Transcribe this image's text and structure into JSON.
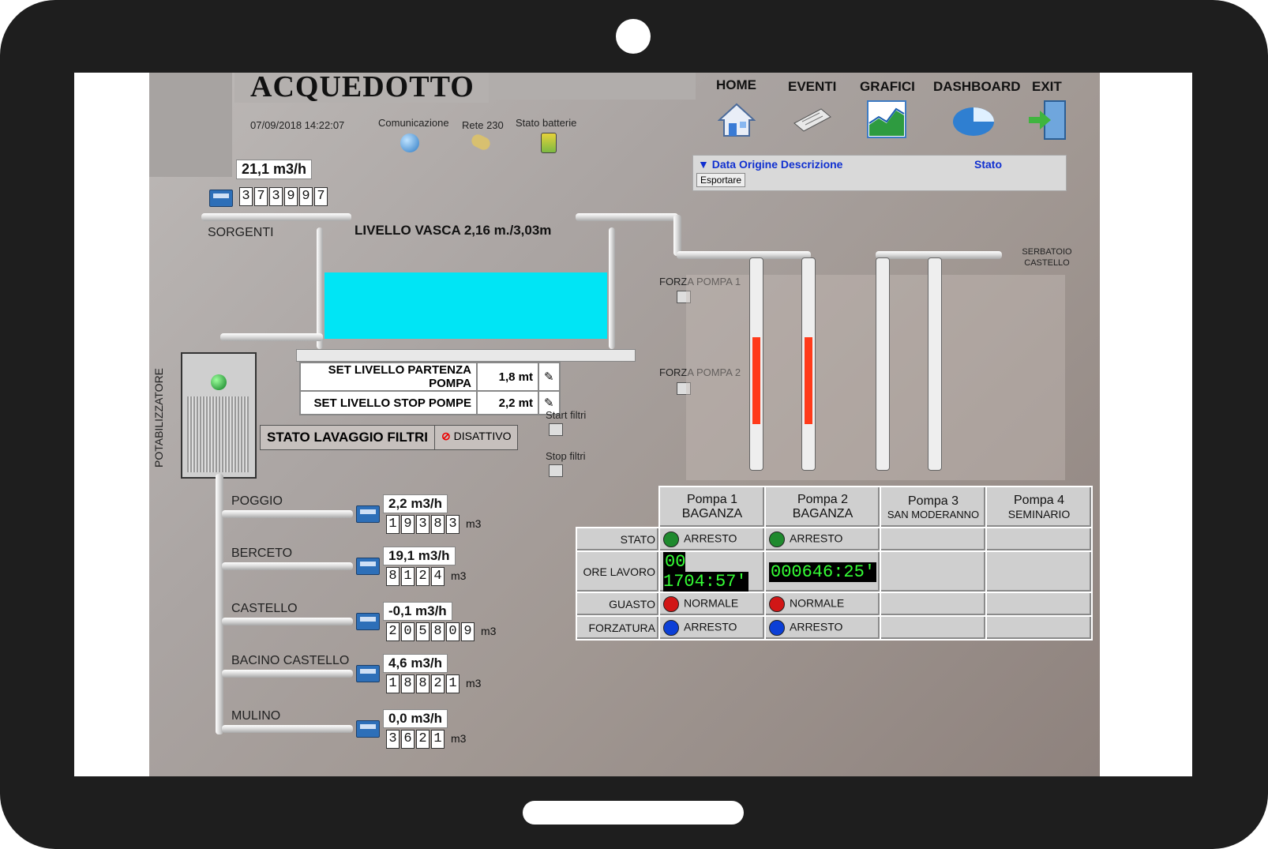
{
  "header": {
    "title": "ACQUEDOTTO",
    "datetime": "07/09/2018 14:22:07",
    "status_icons": [
      {
        "label": "Comunicazione",
        "icon": "globe-check-icon"
      },
      {
        "label": "Rete 230",
        "icon": "plug-icon"
      },
      {
        "label": "Stato batterie",
        "icon": "battery-icon"
      }
    ]
  },
  "nav": [
    {
      "label": "HOME",
      "icon": "home-icon"
    },
    {
      "label": "EVENTI",
      "icon": "newspaper-icon"
    },
    {
      "label": "GRAFICI",
      "icon": "chart-icon"
    },
    {
      "label": "DASHBOARD",
      "icon": "pie-icon"
    },
    {
      "label": "EXIT",
      "icon": "exit-door-icon"
    }
  ],
  "events": {
    "columns": "Data Origine Descrizione",
    "stato": "Stato",
    "export": "Esportare"
  },
  "sorgenti": {
    "label": "SORGENTI",
    "flow": "21,1 m3/h",
    "counter": [
      "3",
      "7",
      "3",
      "9",
      "9",
      "7"
    ]
  },
  "vasca": {
    "label": "LIVELLO VASCA  2,16 m./3,03m",
    "fill_fraction": 0.71
  },
  "setpoints": [
    {
      "label": "SET LIVELLO PARTENZA POMPA",
      "value": "1,8 mt"
    },
    {
      "label": "SET LIVELLO STOP POMPE",
      "value": "2,2 mt"
    }
  ],
  "potabilizzatore": "POTABILIZZATORE",
  "lavaggio": {
    "label": "STATO LAVAGGIO FILTRI",
    "state": "DISATTIVO"
  },
  "filters": {
    "start": "Start filtri",
    "stop": "Stop filtri"
  },
  "forza": {
    "p1": "FORZA POMPA 1",
    "p2": "FORZA POMPA 2"
  },
  "serbatoio": "SERBATOIO CASTELLO",
  "lines": [
    {
      "name": "POGGIO",
      "flow": "2,2 m3/h",
      "counter": [
        "1",
        "9",
        "3",
        "8",
        "3"
      ],
      "unit": "m3"
    },
    {
      "name": "BERCETO",
      "flow": "19,1 m3/h",
      "counter": [
        "8",
        "1",
        "2",
        "4"
      ],
      "unit": "m3"
    },
    {
      "name": "CASTELLO",
      "flow": "-0,1 m3/h",
      "counter": [
        "2",
        "0",
        "5",
        "8",
        "0",
        "9"
      ],
      "unit": "m3"
    },
    {
      "name": "BACINO CASTELLO",
      "flow": "4,6 m3/h",
      "counter": [
        "1",
        "8",
        "8",
        "2",
        "1"
      ],
      "unit": "m3"
    },
    {
      "name": "MULINO",
      "flow": "0,0 m3/h",
      "counter": [
        "3",
        "6",
        "2",
        "1"
      ],
      "unit": "m3"
    }
  ],
  "pumps": {
    "headers": [
      {
        "l1": "Pompa 1",
        "l2": "BAGANZA"
      },
      {
        "l1": "Pompa 2",
        "l2": "BAGANZA"
      },
      {
        "l1": "Pompa 3",
        "l2": "SAN MODERANNO"
      },
      {
        "l1": "Pompa 4",
        "l2": "SEMINARIO"
      }
    ],
    "rows": {
      "stato": "STATO",
      "ore": "ORE LAVORO",
      "guasto": "GUASTO",
      "forzatura": "FORZATURA"
    },
    "p1": {
      "stato": "ARRESTO",
      "ore": "00 1704:57'",
      "guasto": "NORMALE",
      "forzatura": "ARRESTO"
    },
    "p2": {
      "stato": "ARRESTO",
      "ore": "000646:25'",
      "guasto": "NORMALE",
      "forzatura": "ARRESTO"
    },
    "colors": {
      "green": "#1f8a2e",
      "red": "#d11616",
      "blue": "#0c3fd6"
    }
  }
}
